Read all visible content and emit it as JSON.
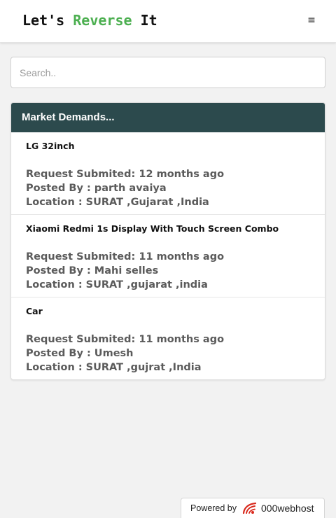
{
  "header": {
    "brand_part1": "Let's ",
    "brand_accent": "Reverse",
    "brand_part2": " It",
    "menu_icon": "≡"
  },
  "search": {
    "placeholder": "Search.."
  },
  "panel": {
    "title": "Market Demands...",
    "items": [
      {
        "title": "LG 32inch",
        "requested": "Request Submited: 12 months ago",
        "posted_by": "Posted By : parth avaiya",
        "location": "Location : SURAT ,Gujarat ,India"
      },
      {
        "title": "Xiaomi Redmi 1s Display With Touch Screen Combo",
        "requested": "Request Submited: 11 months ago",
        "posted_by": "Posted By : Mahi selles",
        "location": "Location : SURAT ,gujarat ,india"
      },
      {
        "title": "Car",
        "requested": "Request Submited: 11 months ago",
        "posted_by": "Posted By : Umesh",
        "location": "Location : SURAT ,gujrat ,India"
      }
    ]
  },
  "footer": {
    "powered_by": "Powered by",
    "host_name": "000webhost",
    "accent_color": "#d9291c"
  }
}
